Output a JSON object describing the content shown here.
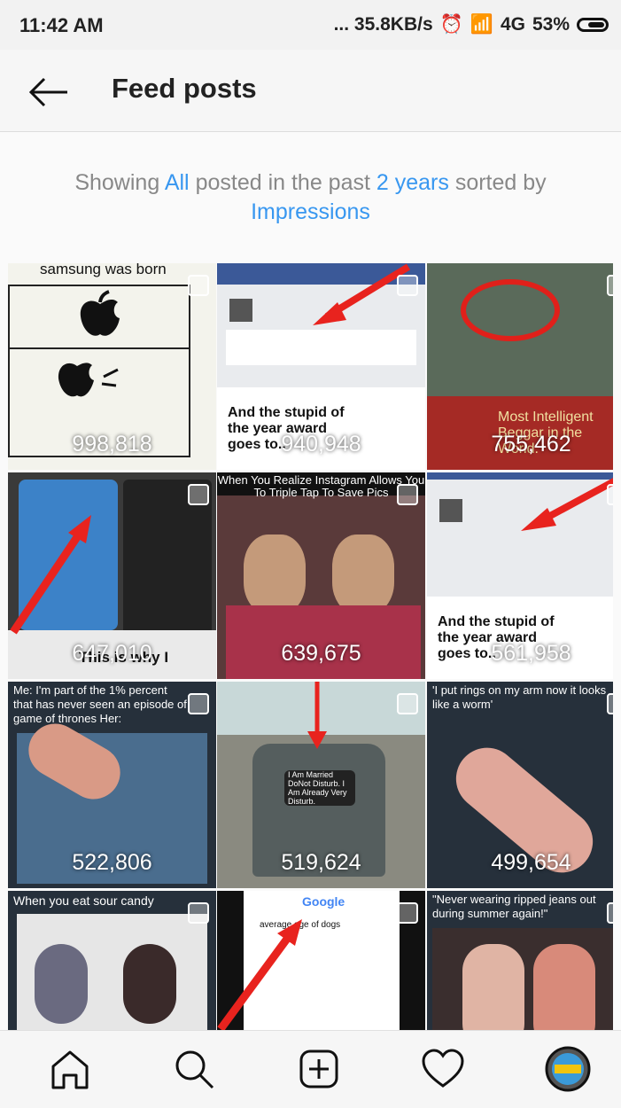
{
  "status_bar": {
    "time": "11:42 AM",
    "net_speed": "... 35.8KB/s",
    "network": "4G",
    "battery": "53%"
  },
  "header": {
    "title": "Feed posts"
  },
  "filter": {
    "prefix": "Showing",
    "scope": "All",
    "middle": "posted in the past",
    "period": "2 years",
    "sorted": "sorted by",
    "metric": "Impressions"
  },
  "posts": [
    {
      "caption": "samsung was born",
      "impressions": "998,818"
    },
    {
      "caption": "And the stupid of the year award goes to..",
      "impressions": "940,948"
    },
    {
      "caption": "Most Intelligent Beggar in the World.",
      "impressions": "755,462"
    },
    {
      "caption": "This is why I",
      "impressions": "647,010"
    },
    {
      "caption": "When You Realize Instagram Allows You To Triple Tap To Save Pics",
      "impressions": "639,675"
    },
    {
      "caption": "And the stupid of the year award goes to..",
      "impressions": "561,958"
    },
    {
      "caption": "Me: I'm part of the 1% percent that has never seen an episode of game of thrones Her:",
      "impressions": "522,806"
    },
    {
      "caption": "I Am Married DoNot Disturb. I Am Already Very Disturb.",
      "impressions": "519,624"
    },
    {
      "caption": "'I put rings on my arm now it looks like a worm'",
      "impressions": "499,654"
    },
    {
      "caption": "When you eat sour candy",
      "impressions": ""
    },
    {
      "caption": "average age of dogs",
      "impressions": ""
    },
    {
      "caption": "\"Never wearing ripped jeans out during summer again!\"",
      "impressions": ""
    }
  ],
  "nav": {
    "items": [
      "home-icon",
      "search-icon",
      "new-post-icon",
      "activity-heart-icon",
      "profile-avatar"
    ]
  }
}
